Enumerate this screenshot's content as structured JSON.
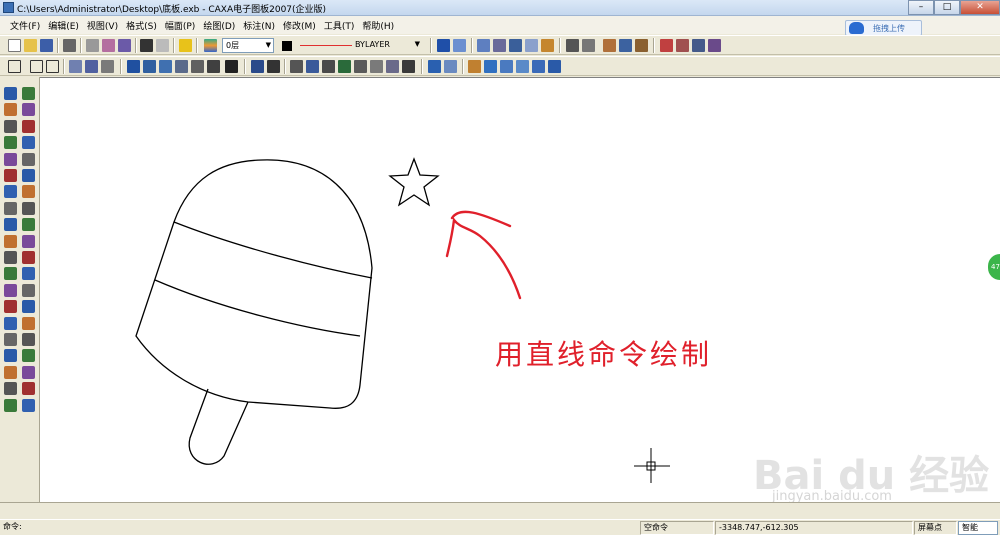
{
  "window": {
    "title": "C:\\Users\\Administrator\\Desktop\\底板.exb - CAXA电子图板2007(企业版)"
  },
  "menu": [
    "文件(F)",
    "编辑(E)",
    "视图(V)",
    "格式(S)",
    "幅面(P)",
    "绘图(D)",
    "标注(N)",
    "修改(M)",
    "工具(T)",
    "帮助(H)"
  ],
  "upload_button": {
    "label": "拖拽上传"
  },
  "toolbar": {
    "layer_value": "0层",
    "linetype_value": "BYLAYER",
    "color_value": "#000000",
    "line_color": "#e03030"
  },
  "canvas": {
    "annotation_text": "用直线命令绘制",
    "annotation_color": "#e0202b",
    "watermark_logo": "Bai du 经验",
    "watermark_url": "jingyan.baidu.com",
    "side_badge": "47"
  },
  "status": {
    "prompt_label": "命令:",
    "command_state": "空命令",
    "coordinates": "-3348.747,-612.305",
    "snap_label": "屏幕点",
    "snap_mode": "智能"
  }
}
